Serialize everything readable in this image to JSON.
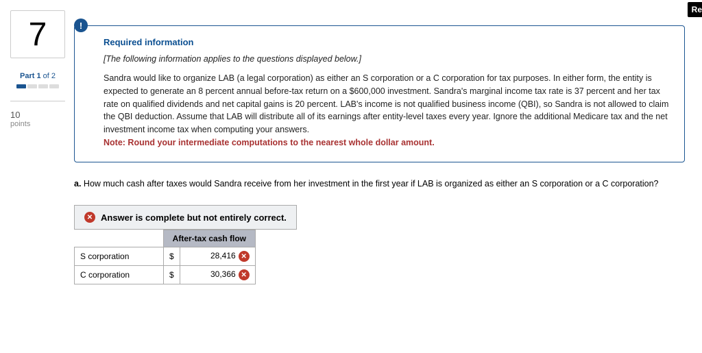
{
  "topRightLabel": "Re",
  "sidebar": {
    "question_number": "7",
    "part_label_prefix": "Part 1",
    "part_label_suffix": " of 2",
    "points_value": "10",
    "points_label": "points"
  },
  "info": {
    "heading": "Required information",
    "italic_line": "[The following information applies to the questions displayed below.]",
    "body": "Sandra would like to organize LAB (a legal corporation) as either an S corporation or a C corporation for tax purposes. In either form, the entity is expected to generate an 8 percent annual before-tax return on a $600,000 investment. Sandra's marginal income tax rate is 37 percent and her tax rate on qualified dividends and net capital gains is 20 percent. LAB's income is not qualified business income (QBI), so Sandra is not allowed to claim the QBI deduction. Assume that LAB will distribute all of its earnings after entity-level taxes every year. Ignore the additional Medicare tax and the net investment income tax when computing your answers.",
    "note": "Note: Round your intermediate computations to the nearest whole dollar amount."
  },
  "question": {
    "letter": "a.",
    "text": " How much cash after taxes would Sandra receive from her investment in the first year if LAB is organized as either an S corporation or a C corporation?"
  },
  "feedback": {
    "banner": "Answer is complete but not entirely correct.",
    "column_header": "After-tax cash flow",
    "rows": [
      {
        "label": "S corporation",
        "currency": "$",
        "value": "28,416"
      },
      {
        "label": "C corporation",
        "currency": "$",
        "value": "30,366"
      }
    ]
  },
  "chart_data": {
    "type": "table",
    "title": "After-tax cash flow",
    "categories": [
      "S corporation",
      "C corporation"
    ],
    "values": [
      28416,
      30366
    ]
  }
}
